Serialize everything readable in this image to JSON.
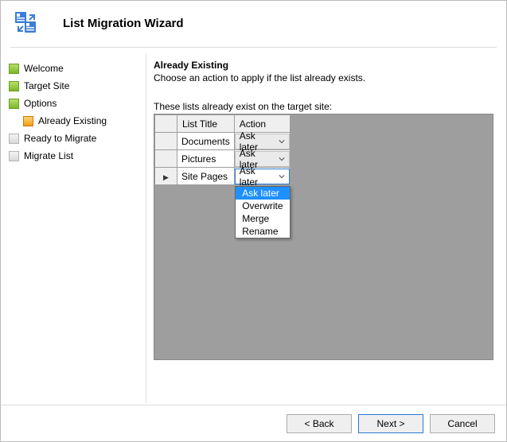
{
  "header": {
    "title": "List Migration Wizard"
  },
  "sidebar": {
    "items": [
      {
        "label": "Welcome",
        "state": "green"
      },
      {
        "label": "Target Site",
        "state": "green"
      },
      {
        "label": "Options",
        "state": "green"
      },
      {
        "label": "Already Existing",
        "state": "amber",
        "sub": true
      },
      {
        "label": "Ready to Migrate",
        "state": "gray"
      },
      {
        "label": "Migrate List",
        "state": "gray"
      }
    ]
  },
  "page": {
    "title": "Already Existing",
    "subtitle": "Choose an action to apply if the list already exists.",
    "grid_label": "These lists already exist on the target site:"
  },
  "grid": {
    "headers": {
      "title": "List Title",
      "action": "Action"
    },
    "rows": [
      {
        "title": "Documents",
        "action": "Ask later",
        "active": false
      },
      {
        "title": "Pictures",
        "action": "Ask later",
        "active": false
      },
      {
        "title": "Site Pages",
        "action": "Ask later",
        "active": true,
        "open": true
      }
    ],
    "options": [
      "Ask later",
      "Overwrite",
      "Merge",
      "Rename"
    ]
  },
  "buttons": {
    "back": "< Back",
    "next": "Next >",
    "cancel": "Cancel"
  }
}
